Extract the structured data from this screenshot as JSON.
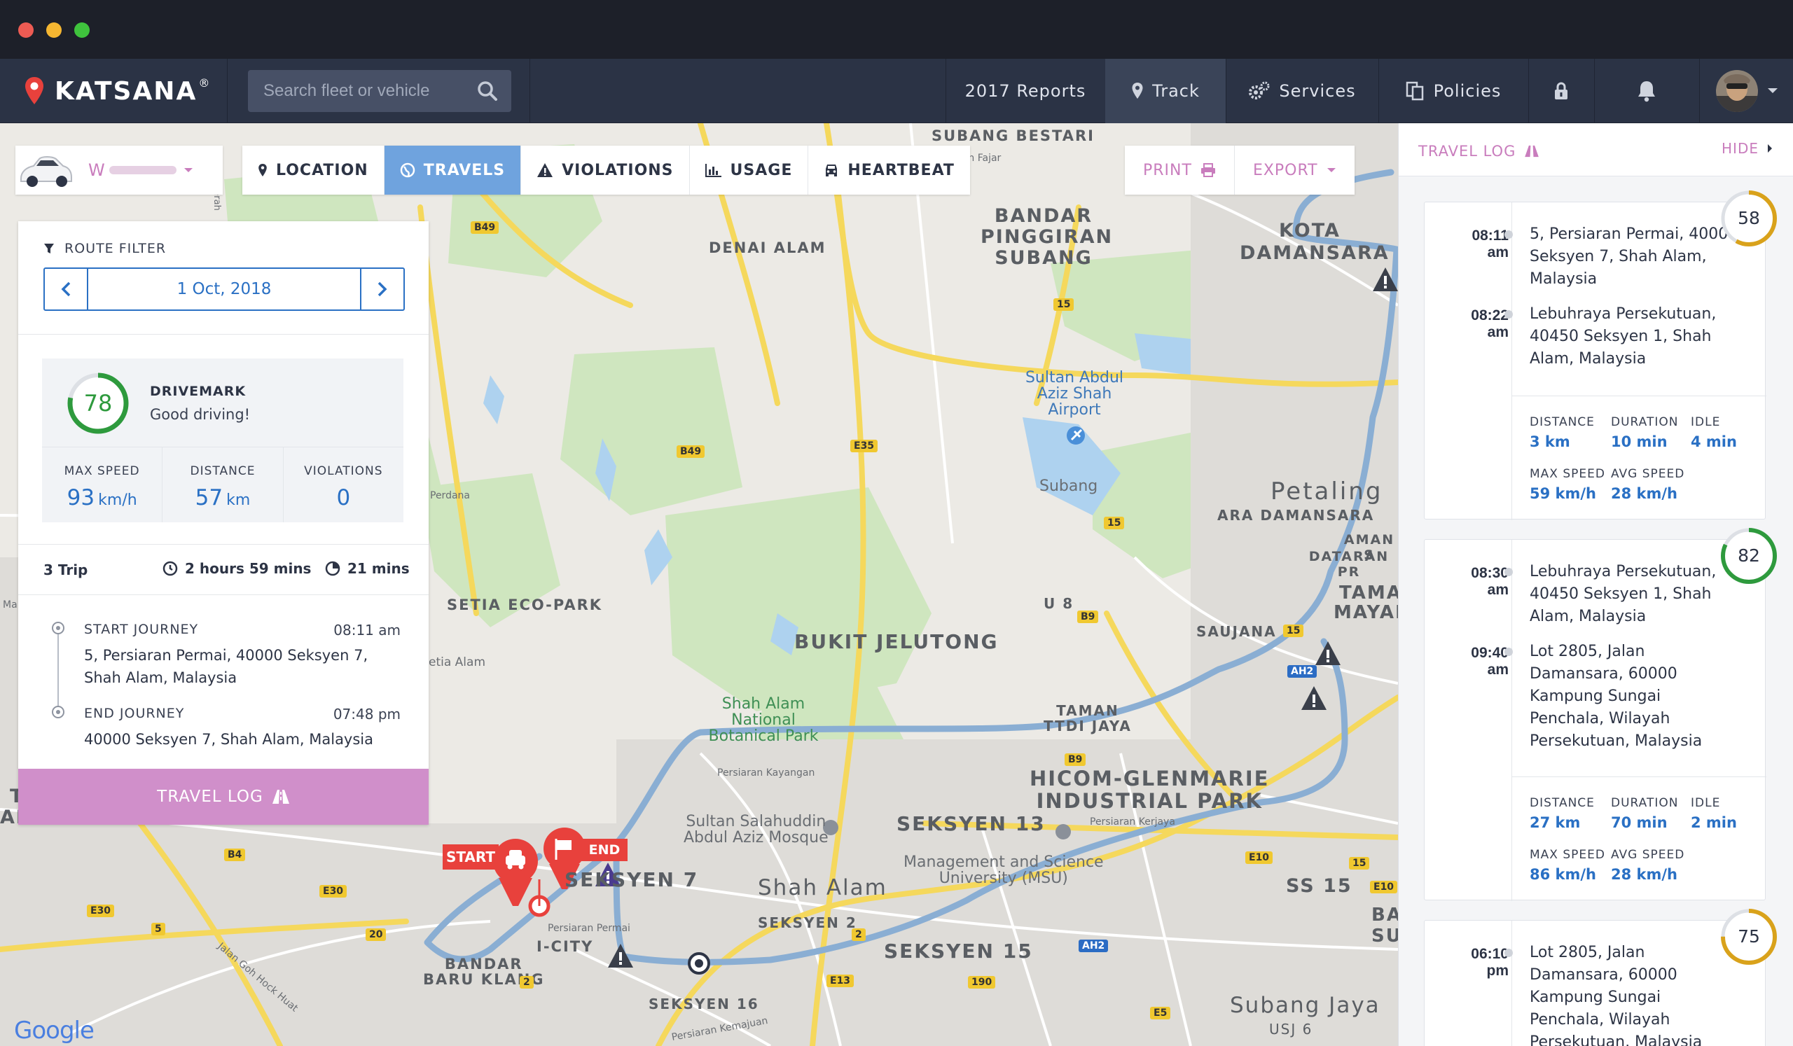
{
  "window": {
    "colors": {
      "close": "#ed5b53",
      "minimize": "#f5b631",
      "maximize": "#3fc33d"
    }
  },
  "header": {
    "brand": "KATSANA",
    "brand_mark": "®",
    "search": {
      "placeholder": "Search fleet or vehicle",
      "value": ""
    },
    "nav": {
      "reports": "2017 Reports",
      "track": "Track",
      "services": "Services",
      "policies": "Policies"
    }
  },
  "vehicle": {
    "plate": "W"
  },
  "tabs": {
    "location": "LOCATION",
    "travels": "TRAVELS",
    "violations": "VIOLATIONS",
    "usage": "USAGE",
    "heartbeat": "HEARTBEAT"
  },
  "actions": {
    "print": "PRINT",
    "export": "EXPORT"
  },
  "route_filter": {
    "title": "ROUTE FILTER",
    "date": "1 Oct, 2018"
  },
  "drivemark": {
    "score": "78",
    "score_fraction": 0.78,
    "title": "DRIVEMARK",
    "subtitle": "Good driving!"
  },
  "summary": {
    "max_speed": {
      "label": "MAX SPEED",
      "value": "93",
      "unit": "km/h"
    },
    "distance": {
      "label": "DISTANCE",
      "value": "57",
      "unit": "km"
    },
    "violations": {
      "label": "VIOLATIONS",
      "value": "0"
    }
  },
  "trip_info": {
    "count": "3 Trip",
    "duration": "2 hours 59 mins",
    "idle": "21 mins"
  },
  "journey": {
    "start": {
      "label": "START JOURNEY",
      "time": "08:11 am",
      "address": "5, Persiaran Permai, 40000 Seksyen 7, Shah Alam, Malaysia"
    },
    "end": {
      "label": "END JOURNEY",
      "time": "07:48 pm",
      "address": "40000 Seksyen 7, Shah Alam, Malaysia"
    }
  },
  "travel_log_button": "TRAVEL LOG",
  "map": {
    "labels": {
      "subang_bestari": "SUBANG BESTARI",
      "persiaran_fajar": "Persiaran Fajar",
      "bandar_pinggiran_1": "BANDAR",
      "bandar_pinggiran_2": "PINGGIRAN",
      "bandar_pinggiran_3": "SUBANG",
      "kota_1": "KOTA",
      "kota_2": "DAMANSARA",
      "denai_alam": "DENAI ALAM",
      "airport_1": "Sultan Abdul",
      "airport_2": "Aziz Shah",
      "airport_3": "Airport",
      "subang": "Subang",
      "petaling": "Petaling",
      "ara_damansara": "ARA DAMANSARA",
      "aman_s": "AMAN S",
      "datar": "DATARAN PR",
      "tama": "TAMA",
      "mayai": "MAYAI",
      "perdana": "Perdana",
      "setia_eco_park": "SETIA ECO-PARK",
      "setia_alam": "etia Alam",
      "u8": "U 8",
      "saujana": "SAUJANA",
      "bukit_jelutong": "BUKIT JELUTONG",
      "shah_alam_np_1": "Shah Alam",
      "shah_alam_np_2": "National",
      "shah_alam_np_3": "Botanical Park",
      "taman_1": "TAMAN",
      "taman_2": "TTDI JAYA",
      "hicom_1": "HICOM-GLENMARIE",
      "hicom_2": "INDUSTRIAL PARK",
      "persiaran_kayangan": "Persiaran Kayangan",
      "mosque_1": "Sultan Salahuddin",
      "mosque_2": "Abdul Aziz Mosque",
      "seksyen_13": "SEKSYEN 13",
      "persiaran_kerjaya": "Persiaran Kerjaya",
      "msu_1": "Management and Science",
      "msu_2": "University (MSU)",
      "seksyen_7": "SEKSYEN 7",
      "shah_alam": "Shah Alam",
      "seksyen_2": "SEKSYEN 2",
      "seksyen_15": "SEKSYEN 15",
      "ss15": "SS 15",
      "i_city": "I-CITY",
      "persiaran_permai": "Persiaran Permai",
      "bandar_baru_1": "BANDAR",
      "bandar_baru_2": "BARU KLANG",
      "seksyen_16": "SEKSYEN 16",
      "persiaran_kemajuan": "Persiaran Kemajuan",
      "jalan_goh": "Jalan Goh Hock Huat",
      "subang_jaya": "Subang Jaya",
      "usj6": "USJ 6",
      "ba": "BA",
      "su": "SU",
      "ma": "Ma",
      "t": "T",
      "an": "AN",
      "cerah": "Cerah"
    },
    "shields": {
      "b49a": "B49",
      "b49b": "B49",
      "e35": "E35",
      "r15a": "15",
      "r15b": "15",
      "r15c": "15",
      "b9a": "B9",
      "b9b": "B9",
      "b4": "B4",
      "e30a": "E30",
      "e30b": "E30",
      "r20": "20",
      "r5": "5",
      "r2a": "2",
      "r2b": "2",
      "e13": "E13",
      "r190": "190",
      "ah2a": "AH2",
      "ah2b": "AH2",
      "e10": "E10",
      "r15d": "15",
      "e1": "E10",
      "e5": "E5"
    },
    "markers": {
      "start": "START",
      "end": "END"
    },
    "google": "Google",
    "route_color": "#8aaed3"
  },
  "travel_log": {
    "title": "TRAVEL LOG",
    "hide": "HIDE",
    "trips": [
      {
        "score": "58",
        "score_fraction": 0.58,
        "ring_color": "#d9a21b",
        "stops": [
          {
            "time": "08:11",
            "ampm": "am",
            "address": "5, Persiaran Permai, 40000 Seksyen 7, Shah Alam, Malaysia"
          },
          {
            "time": "08:22",
            "ampm": "am",
            "address": "Lebuhraya Persekutuan, 40450 Seksyen 1, Shah Alam, Malaysia"
          }
        ],
        "stats": {
          "distance": {
            "label": "DISTANCE",
            "value": "3 km"
          },
          "duration": {
            "label": "DURATION",
            "value": "10 min"
          },
          "idle": {
            "label": "IDLE",
            "value": "4 min"
          },
          "max_speed": {
            "label": "MAX SPEED",
            "value": "59 km/h"
          },
          "avg_speed": {
            "label": "AVG SPEED",
            "value": "28 km/h"
          }
        }
      },
      {
        "score": "82",
        "score_fraction": 0.82,
        "ring_color": "#2e9a3d",
        "stops": [
          {
            "time": "08:30",
            "ampm": "am",
            "address": "Lebuhraya Persekutuan, 40450 Seksyen 1, Shah Alam, Malaysia"
          },
          {
            "time": "09:40",
            "ampm": "am",
            "address": "Lot 2805, Jalan Damansara, 60000 Kampung Sungai Penchala, Wilayah Persekutuan, Malaysia"
          }
        ],
        "stats": {
          "distance": {
            "label": "DISTANCE",
            "value": "27 km"
          },
          "duration": {
            "label": "DURATION",
            "value": "70 min"
          },
          "idle": {
            "label": "IDLE",
            "value": "2 min"
          },
          "max_speed": {
            "label": "MAX SPEED",
            "value": "86 km/h"
          },
          "avg_speed": {
            "label": "AVG SPEED",
            "value": "28 km/h"
          }
        }
      },
      {
        "score": "75",
        "score_fraction": 0.75,
        "ring_color": "#d9a21b",
        "stops": [
          {
            "time": "06:10",
            "ampm": "pm",
            "address": "Lot 2805, Jalan Damansara, 60000 Kampung Sungai Penchala, Wilayah Persekutuan, Malaysia"
          }
        ]
      }
    ]
  }
}
